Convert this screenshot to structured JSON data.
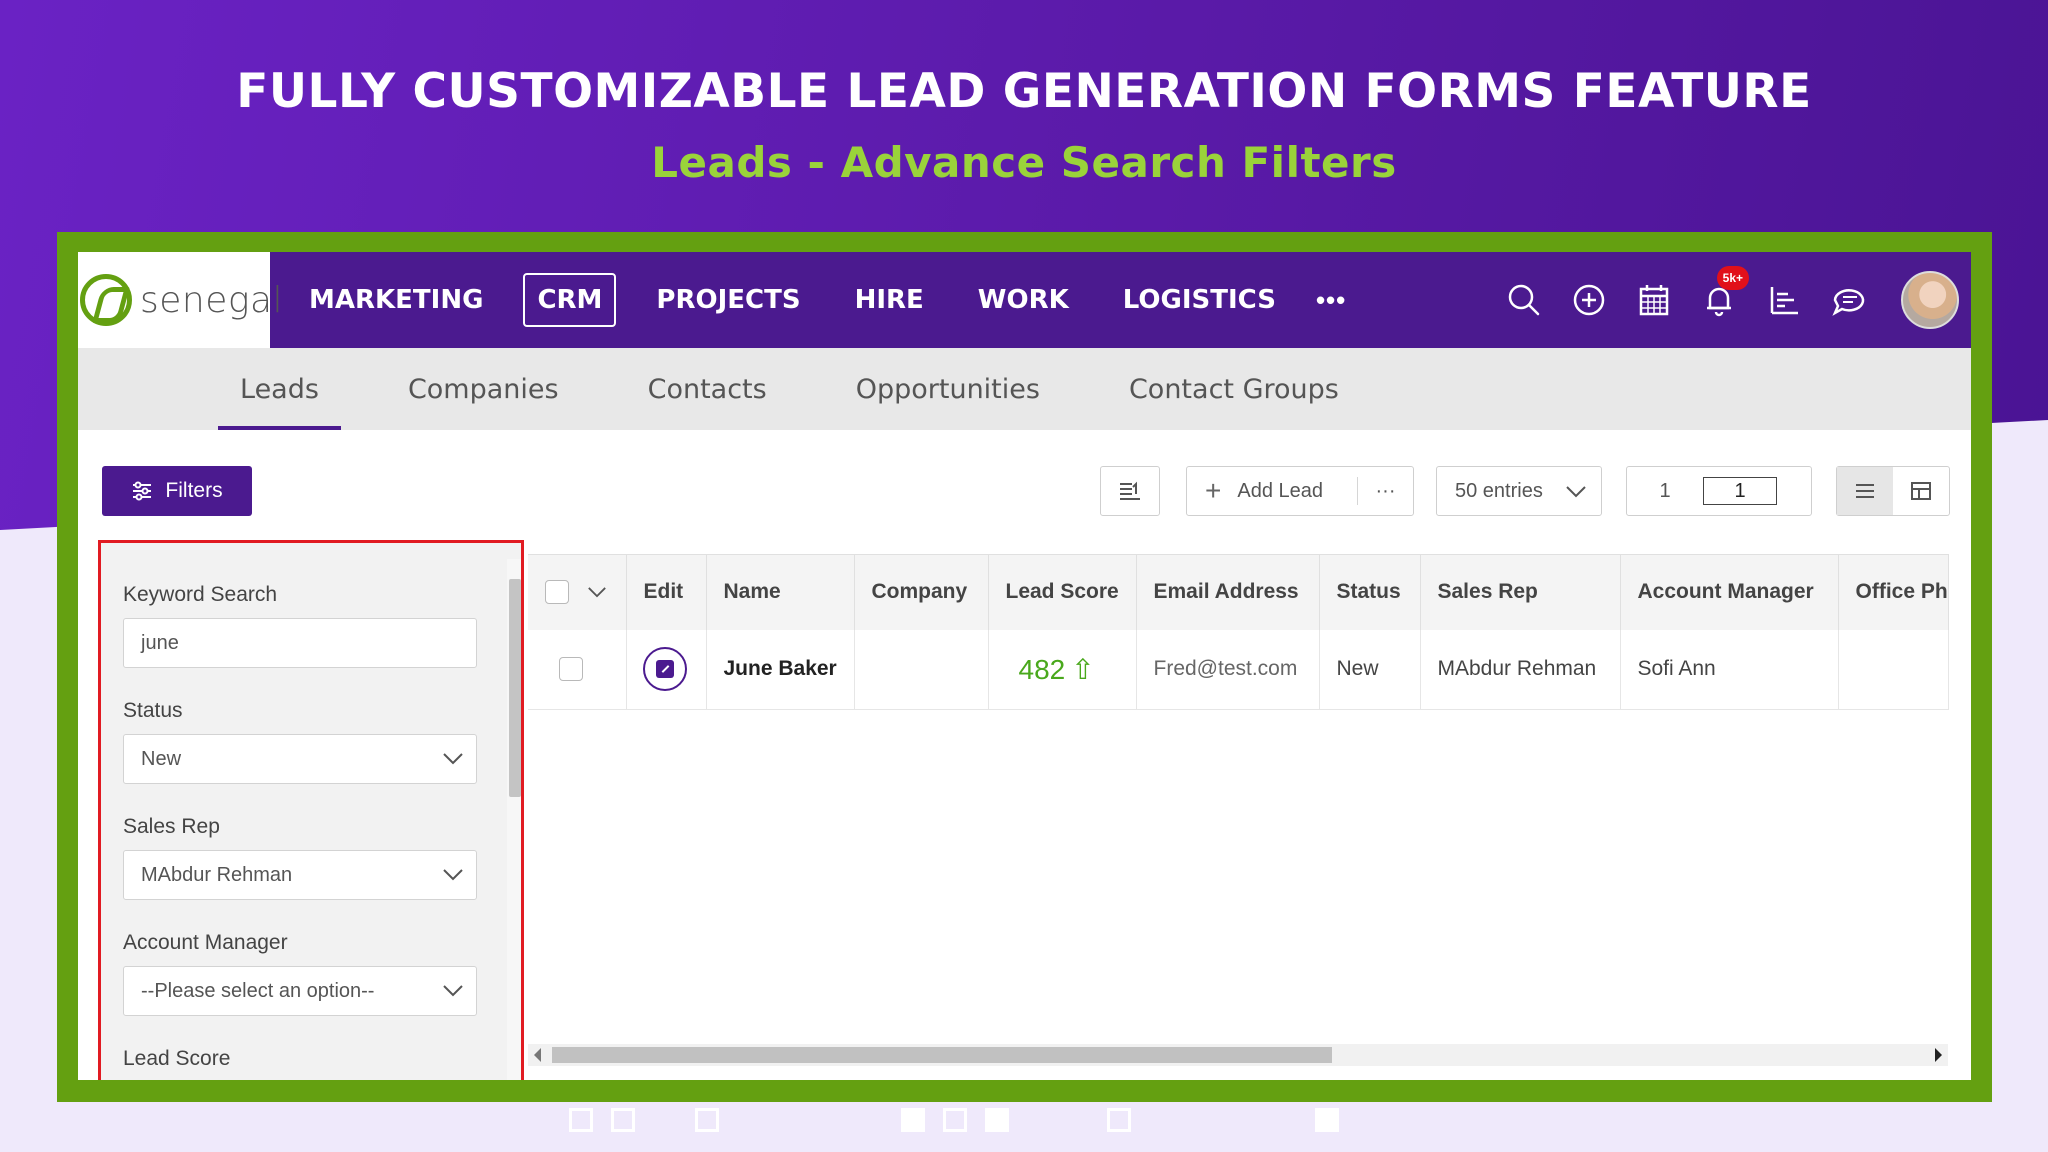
{
  "hero": {
    "title": "FULLY CUSTOMIZABLE LEAD GENERATION FORMS FEATURE",
    "subtitle": "Leads - Advance Search Filters"
  },
  "brand": {
    "name": "senegal",
    "accent": "#64a011",
    "primary": "#4b1a8f"
  },
  "topnav": {
    "items": [
      "MARKETING",
      "CRM",
      "PROJECTS",
      "HIRE",
      "WORK",
      "LOGISTICS"
    ],
    "active": "CRM",
    "more": "•••",
    "notification_badge": "5k+",
    "icons": [
      "search-icon",
      "add-icon",
      "calendar-icon",
      "bell-icon",
      "chart-icon",
      "chat-icon"
    ]
  },
  "subtabs": [
    "Leads",
    "Companies",
    "Contacts",
    "Opportunities",
    "Contact Groups"
  ],
  "toolbar": {
    "filters_label": "Filters",
    "add_lead_label": "Add Lead",
    "more_label": "···",
    "entries_label": "50 entries",
    "page_current": "1",
    "page_input": "1"
  },
  "filters": {
    "keyword_label": "Keyword Search",
    "keyword_value": "june",
    "status_label": "Status",
    "status_value": "New",
    "sales_rep_label": "Sales Rep",
    "sales_rep_value": "MAbdur Rehman",
    "account_manager_label": "Account Manager",
    "account_manager_value": "--Please select an option--",
    "lead_score_label": "Lead Score"
  },
  "table": {
    "headers": [
      "Edit",
      "Name",
      "Company",
      "Lead Score",
      "Email Address",
      "Status",
      "Sales Rep",
      "Account Manager",
      "Office Ph"
    ],
    "rows": [
      {
        "name": "June Baker",
        "company": "",
        "lead_score": "482",
        "score_arrow": "⇧",
        "email": "Fred@test.com",
        "status": "New",
        "sales_rep": "MAbdur Rehman",
        "account_manager": "Sofi Ann",
        "office_phone": ""
      }
    ]
  }
}
